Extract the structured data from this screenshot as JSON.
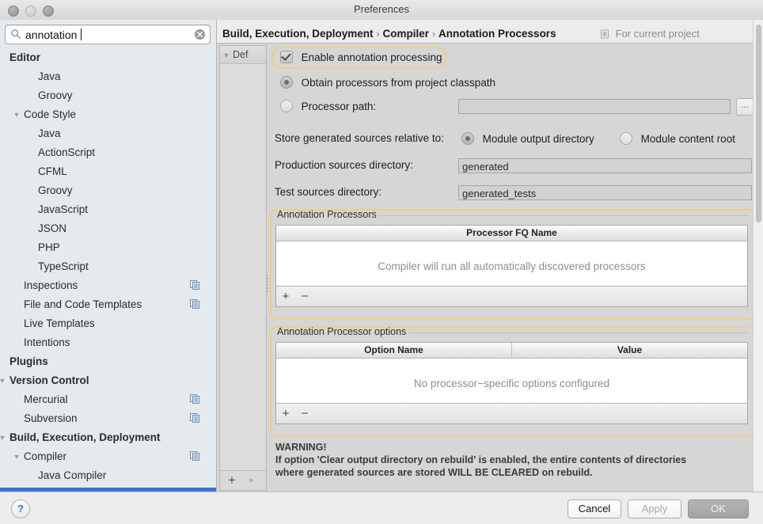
{
  "window": {
    "title": "Preferences",
    "traffic_lights": [
      "close-button",
      "minimize-button",
      "zoom-button"
    ]
  },
  "sidebar": {
    "search": {
      "value": "annotation",
      "placeholder": "Search",
      "icon": "search-icon",
      "clear_icon": "clear-icon"
    },
    "items": [
      {
        "label": "Editor",
        "level": 0,
        "bold": true,
        "arrow": "",
        "badge": false
      },
      {
        "label": "Java",
        "level": 2,
        "bold": false,
        "arrow": "",
        "badge": false
      },
      {
        "label": "Groovy",
        "level": 2,
        "bold": false,
        "arrow": "",
        "badge": false
      },
      {
        "label": "Code Style",
        "level": 1,
        "bold": false,
        "arrow": "▼",
        "badge": false
      },
      {
        "label": "Java",
        "level": 2,
        "bold": false,
        "arrow": "",
        "badge": false
      },
      {
        "label": "ActionScript",
        "level": 2,
        "bold": false,
        "arrow": "",
        "badge": false
      },
      {
        "label": "CFML",
        "level": 2,
        "bold": false,
        "arrow": "",
        "badge": false
      },
      {
        "label": "Groovy",
        "level": 2,
        "bold": false,
        "arrow": "",
        "badge": false
      },
      {
        "label": "JavaScript",
        "level": 2,
        "bold": false,
        "arrow": "",
        "badge": false
      },
      {
        "label": "JSON",
        "level": 2,
        "bold": false,
        "arrow": "",
        "badge": false
      },
      {
        "label": "PHP",
        "level": 2,
        "bold": false,
        "arrow": "",
        "badge": false
      },
      {
        "label": "TypeScript",
        "level": 2,
        "bold": false,
        "arrow": "",
        "badge": false
      },
      {
        "label": "Inspections",
        "level": 1,
        "bold": false,
        "arrow": "",
        "badge": true
      },
      {
        "label": "File and Code Templates",
        "level": 1,
        "bold": false,
        "arrow": "",
        "badge": true
      },
      {
        "label": "Live Templates",
        "level": 1,
        "bold": false,
        "arrow": "",
        "badge": false
      },
      {
        "label": "Intentions",
        "level": 1,
        "bold": false,
        "arrow": "",
        "badge": false
      },
      {
        "label": "Plugins",
        "level": 0,
        "bold": true,
        "arrow": "",
        "badge": false
      },
      {
        "label": "Version Control",
        "level": 0,
        "bold": true,
        "arrow": "▼",
        "badge": false
      },
      {
        "label": "Mercurial",
        "level": 1,
        "bold": false,
        "arrow": "",
        "badge": true
      },
      {
        "label": "Subversion",
        "level": 1,
        "bold": false,
        "arrow": "",
        "badge": true
      },
      {
        "label": "Build, Execution, Deployment",
        "level": 0,
        "bold": true,
        "arrow": "▼",
        "badge": false
      },
      {
        "label": "Compiler",
        "level": 1,
        "bold": false,
        "arrow": "▼",
        "badge": true
      },
      {
        "label": "Java Compiler",
        "level": 2,
        "bold": false,
        "arrow": "",
        "badge": false
      }
    ]
  },
  "header": {
    "breadcrumb": [
      "Build, Execution, Deployment",
      "Compiler",
      "Annotation Processors"
    ],
    "separator": "›",
    "scope_hint": "For current project",
    "scope_icon": "project-scope-icon"
  },
  "profile_panel": {
    "title": "Def",
    "arrow": "▼",
    "add_label": "+",
    "expand_label": "»"
  },
  "main": {
    "enable_checkbox": {
      "label": "Enable annotation processing",
      "checked": true
    },
    "source_radio_group": [
      {
        "label": "Obtain processors from project classpath",
        "selected": true
      },
      {
        "label": "Processor path:",
        "selected": false
      }
    ],
    "processor_path": {
      "value": "",
      "browse_label": "…"
    },
    "store_relative_label": "Store generated sources relative to:",
    "store_relative_options": [
      {
        "label": "Module output directory",
        "selected": true
      },
      {
        "label": "Module content root",
        "selected": false
      }
    ],
    "production_sources": {
      "label": "Production sources directory:",
      "value": "generated"
    },
    "test_sources": {
      "label": "Test sources directory:",
      "value": "generated_tests"
    },
    "processors_group": {
      "title": "Annotation Processors",
      "columns": [
        "Processor FQ Name"
      ],
      "rows": [],
      "empty_text": "Compiler will run all automatically discovered processors",
      "add_label": "+",
      "remove_label": "−"
    },
    "options_group": {
      "title": "Annotation Processor options",
      "columns": [
        "Option Name",
        "Value"
      ],
      "rows": [],
      "empty_text": "No processor−specific options configured",
      "add_label": "+",
      "remove_label": "−"
    },
    "warning": [
      "WARNING!",
      "If option 'Clear output directory on rebuild' is enabled, the entire contents of directories",
      "where generated sources are stored WILL BE CLEARED on rebuild."
    ]
  },
  "footer": {
    "help_label": "?",
    "cancel_label": "Cancel",
    "apply_label": "Apply",
    "apply_enabled": false,
    "ok_label": "OK"
  },
  "colors": {
    "highlight_ring": "#e8cf8a",
    "selection_bar": "#3b76d8",
    "window_bg": "#ececec",
    "sidebar_bg": "#e5eaee",
    "panel_bg": "#d6d6d6",
    "help_blue": "#2f6fd0"
  }
}
